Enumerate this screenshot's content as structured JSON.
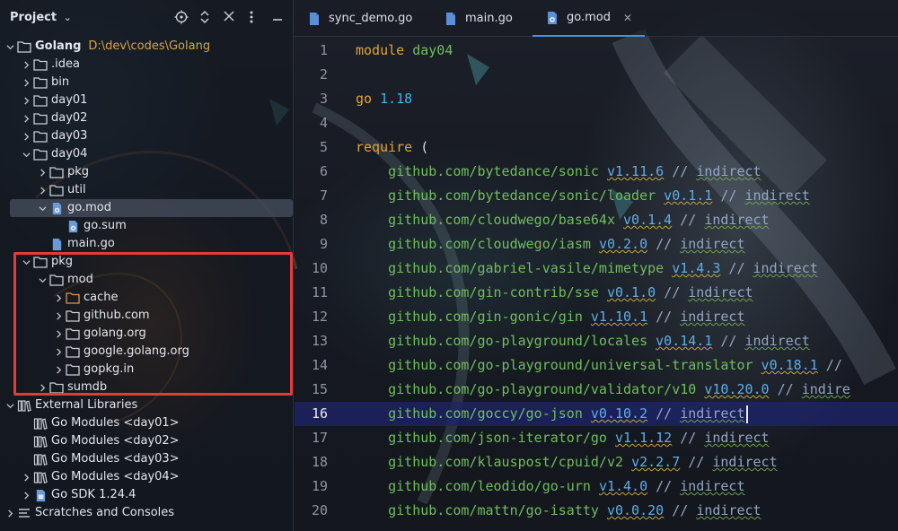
{
  "project_panel": {
    "title": "Project",
    "header_icons": [
      "locate-icon",
      "expand-collapse-icon",
      "close-icon",
      "more-icon"
    ]
  },
  "tree": [
    {
      "id": "root",
      "depth": 0,
      "expanded": true,
      "icon": "folder",
      "label": "Golang",
      "bold": true,
      "path": "D:\\dev\\codes\\Golang"
    },
    {
      "id": "idea",
      "depth": 1,
      "expanded": false,
      "icon": "folder",
      "label": ".idea"
    },
    {
      "id": "bin",
      "depth": 1,
      "expanded": false,
      "icon": "folder",
      "label": "bin"
    },
    {
      "id": "day01",
      "depth": 1,
      "expanded": false,
      "icon": "folder",
      "label": "day01"
    },
    {
      "id": "day02",
      "depth": 1,
      "expanded": false,
      "icon": "folder",
      "label": "day02"
    },
    {
      "id": "day03",
      "depth": 1,
      "expanded": false,
      "icon": "folder",
      "label": "day03"
    },
    {
      "id": "day04",
      "depth": 1,
      "expanded": true,
      "icon": "folder",
      "label": "day04"
    },
    {
      "id": "day04-pkg",
      "depth": 2,
      "expanded": false,
      "icon": "folder",
      "label": "pkg"
    },
    {
      "id": "day04-util",
      "depth": 2,
      "expanded": false,
      "icon": "folder",
      "label": "util"
    },
    {
      "id": "gomod",
      "depth": 2,
      "expanded": true,
      "icon": "gomod",
      "label": "go.mod",
      "selected": true
    },
    {
      "id": "gosum",
      "depth": 3,
      "expanded": null,
      "icon": "gomod",
      "label": "go.sum"
    },
    {
      "id": "maingo",
      "depth": 2,
      "expanded": null,
      "icon": "gofile",
      "label": "main.go"
    },
    {
      "id": "pkg",
      "depth": 1,
      "expanded": true,
      "icon": "folder",
      "label": "pkg"
    },
    {
      "id": "mod",
      "depth": 2,
      "expanded": true,
      "icon": "folder",
      "label": "mod"
    },
    {
      "id": "cache",
      "depth": 3,
      "expanded": false,
      "icon": "folder-orange",
      "label": "cache"
    },
    {
      "id": "github",
      "depth": 3,
      "expanded": false,
      "icon": "folder",
      "label": "github.com"
    },
    {
      "id": "golang",
      "depth": 3,
      "expanded": false,
      "icon": "folder",
      "label": "golang.org"
    },
    {
      "id": "google",
      "depth": 3,
      "expanded": false,
      "icon": "folder",
      "label": "google.golang.org"
    },
    {
      "id": "gopkg",
      "depth": 3,
      "expanded": false,
      "icon": "folder",
      "label": "gopkg.in"
    },
    {
      "id": "sumdb",
      "depth": 2,
      "expanded": false,
      "icon": "folder",
      "label": "sumdb"
    },
    {
      "id": "extlib",
      "depth": 0,
      "expanded": true,
      "icon": "library",
      "label": "External Libraries"
    },
    {
      "id": "gm1",
      "depth": 1,
      "expanded": null,
      "icon": "library",
      "label": "Go Modules <day01>"
    },
    {
      "id": "gm2",
      "depth": 1,
      "expanded": null,
      "icon": "library",
      "label": "Go Modules <day02>"
    },
    {
      "id": "gm3",
      "depth": 1,
      "expanded": null,
      "icon": "library",
      "label": "Go Modules <day03>"
    },
    {
      "id": "gm4",
      "depth": 1,
      "expanded": false,
      "icon": "library",
      "label": "Go Modules <day04>"
    },
    {
      "id": "gosdk",
      "depth": 1,
      "expanded": false,
      "icon": "gosdk",
      "label": "Go SDK 1.24.4"
    },
    {
      "id": "scratch",
      "depth": 0,
      "expanded": false,
      "icon": "scratch",
      "label": "Scratches and Consoles"
    }
  ],
  "tabs": [
    {
      "label": "sync_demo.go",
      "active": false
    },
    {
      "label": "main.go",
      "active": false
    },
    {
      "label": "go.mod",
      "active": true
    }
  ],
  "editor": {
    "current_line": 16,
    "lines": [
      {
        "n": "1",
        "kind": "module",
        "kw": "module",
        "name": "day04"
      },
      {
        "n": "2",
        "kind": "blank"
      },
      {
        "n": "3",
        "kind": "go",
        "kw": "go",
        "version": "1.18"
      },
      {
        "n": "4",
        "kind": "blank"
      },
      {
        "n": "5",
        "kind": "require",
        "kw": "require",
        "rest": " ("
      },
      {
        "n": "6",
        "kind": "dep",
        "path": "github.com/bytedance/sonic",
        "version": "v1.11.6",
        "comment": "// ",
        "indirect": "indirect"
      },
      {
        "n": "7",
        "kind": "dep",
        "path": "github.com/bytedance/sonic/loader",
        "version": "v0.1.1",
        "comment": "// ",
        "indirect": "indirect"
      },
      {
        "n": "8",
        "kind": "dep",
        "path": "github.com/cloudwego/base64x",
        "version": "v0.1.4",
        "comment": "// ",
        "indirect": "indirect"
      },
      {
        "n": "9",
        "kind": "dep",
        "path": "github.com/cloudwego/iasm",
        "version": "v0.2.0",
        "comment": "// ",
        "indirect": "indirect"
      },
      {
        "n": "10",
        "kind": "dep",
        "path": "github.com/gabriel-vasile/mimetype",
        "version": "v1.4.3",
        "comment": "// ",
        "indirect": "indirect"
      },
      {
        "n": "11",
        "kind": "dep",
        "path": "github.com/gin-contrib/sse",
        "version": "v0.1.0",
        "comment": "// ",
        "indirect": "indirect"
      },
      {
        "n": "12",
        "kind": "dep",
        "path": "github.com/gin-gonic/gin",
        "version": "v1.10.1",
        "comment": "// ",
        "indirect": "indirect"
      },
      {
        "n": "13",
        "kind": "dep",
        "path": "github.com/go-playground/locales",
        "version": "v0.14.1",
        "comment": "// ",
        "indirect": "indirect"
      },
      {
        "n": "14",
        "kind": "dep",
        "path": "github.com/go-playground/universal-translator",
        "version": "v0.18.1",
        "comment": "//",
        "indirect": ""
      },
      {
        "n": "15",
        "kind": "dep",
        "path": "github.com/go-playground/validator/v10",
        "version": "v10.20.0",
        "comment": "// ",
        "indirect": "indire"
      },
      {
        "n": "16",
        "kind": "dep",
        "path": "github.com/goccy/go-json",
        "version": "v0.10.2",
        "comment": "// ",
        "indirect": "indirect"
      },
      {
        "n": "17",
        "kind": "dep",
        "path": "github.com/json-iterator/go",
        "version": "v1.1.12",
        "comment": "// ",
        "indirect": "indirect"
      },
      {
        "n": "18",
        "kind": "dep",
        "path": "github.com/klauspost/cpuid/v2",
        "version": "v2.2.7",
        "comment": "// ",
        "indirect": "indirect"
      },
      {
        "n": "19",
        "kind": "dep",
        "path": "github.com/leodido/go-urn",
        "version": "v1.4.0",
        "comment": "// ",
        "indirect": "indirect"
      },
      {
        "n": "20",
        "kind": "dep",
        "path": "github.com/mattn/go-isatty",
        "version": "v0.0.20",
        "comment": "// ",
        "indirect": "indirect"
      }
    ]
  },
  "colors": {
    "highlight_box": "#e23b3b",
    "keyword": "#e0a23c",
    "module_path": "#6fbf5c",
    "version": "#5eaee8",
    "current_line": "#1e246e",
    "active_tab_underline": "#4a8fe7"
  }
}
